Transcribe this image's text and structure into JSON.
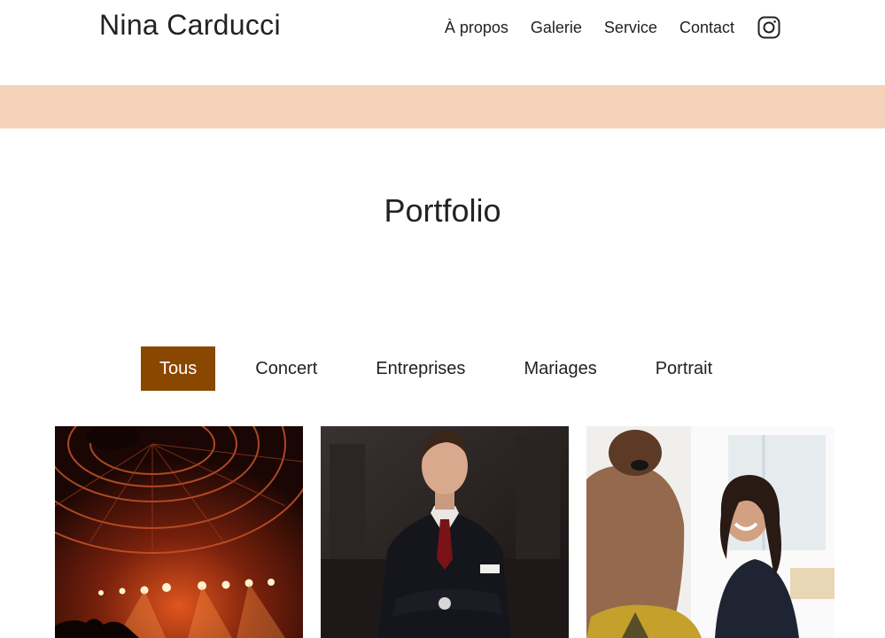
{
  "header": {
    "site_name": "Nina Carducci",
    "nav": [
      {
        "label": "À propos"
      },
      {
        "label": "Galerie"
      },
      {
        "label": "Service"
      },
      {
        "label": "Contact"
      }
    ],
    "social_icon": "instagram-icon"
  },
  "colors": {
    "band": "#f5d3bb",
    "active_filter": "#8a4700"
  },
  "portfolio": {
    "title": "Portfolio",
    "filters": [
      {
        "label": "Tous",
        "active": true
      },
      {
        "label": "Concert",
        "active": false
      },
      {
        "label": "Entreprises",
        "active": false
      },
      {
        "label": "Mariages",
        "active": false
      },
      {
        "label": "Portrait",
        "active": false
      }
    ],
    "photos": [
      {
        "subject": "concert-hall-stage"
      },
      {
        "subject": "businessman-portrait"
      },
      {
        "subject": "office-meeting"
      }
    ]
  }
}
